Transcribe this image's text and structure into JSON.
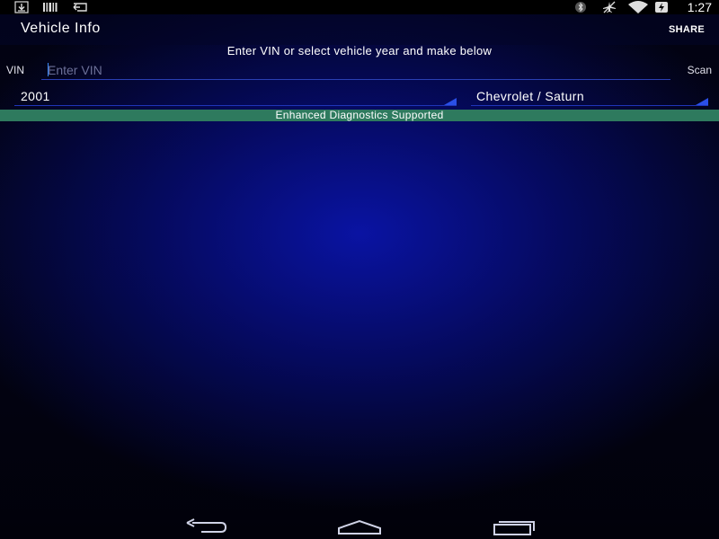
{
  "status_bar": {
    "time": "1:27",
    "icons": [
      "download-icon",
      "barcode-icon",
      "cast-icon",
      "bluetooth-icon",
      "airplane-mode-icon",
      "wifi-icon",
      "battery-charging-icon"
    ]
  },
  "action_bar": {
    "title": "Vehicle Info",
    "share_label": "SHARE"
  },
  "instruction": "Enter VIN or select vehicle year and make below",
  "vin": {
    "label": "VIN",
    "placeholder": "Enter VIN",
    "value": "",
    "scan_label": "Scan"
  },
  "year_spinner": {
    "value": "2001"
  },
  "make_spinner": {
    "value": "Chevrolet / Saturn"
  },
  "banner": "Enhanced Diagnostics Supported",
  "nav_bar": {
    "icons": [
      "back-icon",
      "home-icon",
      "recent-apps-icon"
    ]
  },
  "colors": {
    "accent": "#2a4fe8",
    "banner_bg": "#2e7a5e",
    "background": "#06108a"
  }
}
